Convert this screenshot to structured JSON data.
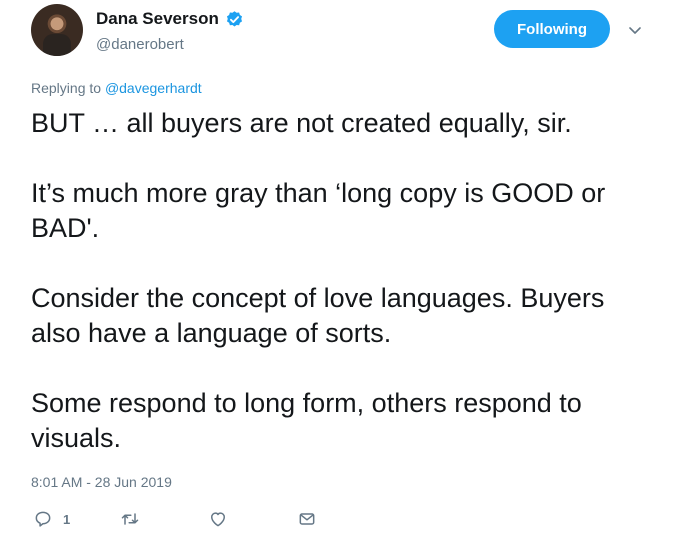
{
  "user": {
    "display_name": "Dana Severson",
    "handle": "@danerobert",
    "verified": true
  },
  "follow_button_label": "Following",
  "reply": {
    "prefix": "Replying to",
    "target": "@davegerhardt"
  },
  "tweet": {
    "paragraphs": [
      "BUT … all buyers are not created equally, sir.",
      "It’s much more gray than ‘long copy is GOOD or BAD'.",
      "Consider the concept of love languages. Buyers also have a language of sorts.",
      "Some respond to long form, others respond to visuals."
    ],
    "timestamp": "8:01 AM - 28 Jun 2019"
  },
  "actions": {
    "reply_count": "1",
    "icons": [
      "reply-icon",
      "retweet-icon",
      "like-icon",
      "message-icon"
    ]
  },
  "colors": {
    "accent": "#1da1f2",
    "link": "#1b95e0",
    "secondary_text": "#657786",
    "primary_text": "#14171a"
  }
}
